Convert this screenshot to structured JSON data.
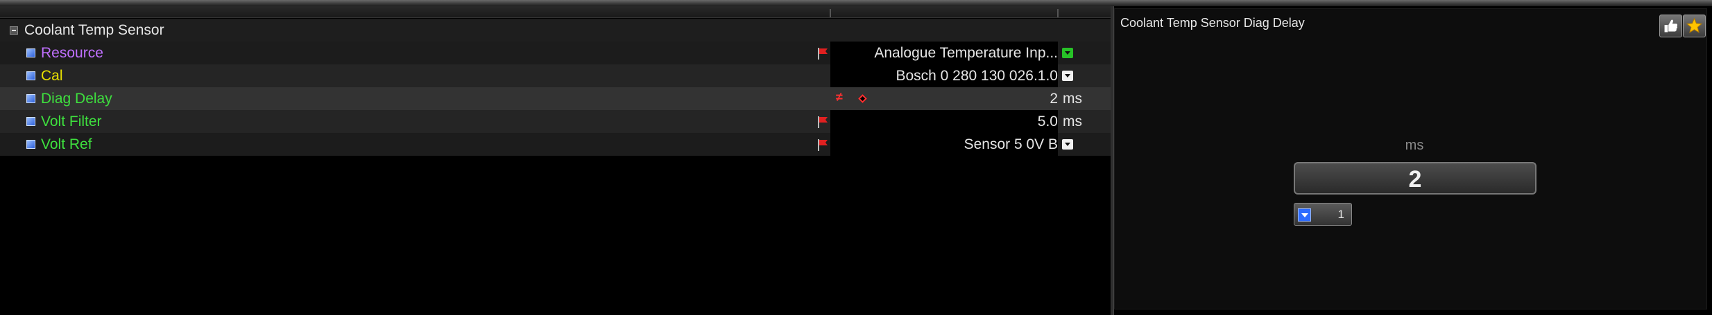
{
  "tree": {
    "group_label": "Coolant Temp Sensor",
    "items": [
      {
        "label": "Resource",
        "value": "Analogue Temperature Inp...",
        "unit": "",
        "label_color": "#c070ff",
        "has_flag": true,
        "dropdown": "green"
      },
      {
        "label": "Cal",
        "value": "Bosch 0 280 130 026.1.0",
        "unit": "",
        "label_color": "#e8e000",
        "has_flag": false,
        "dropdown": "white"
      },
      {
        "label": "Diag Delay",
        "value": "2",
        "unit": "ms",
        "label_color": "#3ee03e",
        "has_flag": false,
        "modified": true,
        "selected": true
      },
      {
        "label": "Volt Filter",
        "value": "5.0",
        "unit": "ms",
        "label_color": "#3ee03e",
        "has_flag": true
      },
      {
        "label": "Volt Ref",
        "value": "Sensor 5 0V B",
        "unit": "",
        "label_color": "#3ee03e",
        "has_flag": true,
        "dropdown": "white"
      }
    ],
    "modified_marker": "≠"
  },
  "detail": {
    "title": "Coolant Temp Sensor Diag Delay",
    "unit": "ms",
    "value": "2",
    "step": "1"
  },
  "icons": {
    "group": "collapse-icon",
    "item": "parameter-icon",
    "flag": "red-flag-icon",
    "thumb": "thumbs-up-icon",
    "star": "star-icon"
  }
}
